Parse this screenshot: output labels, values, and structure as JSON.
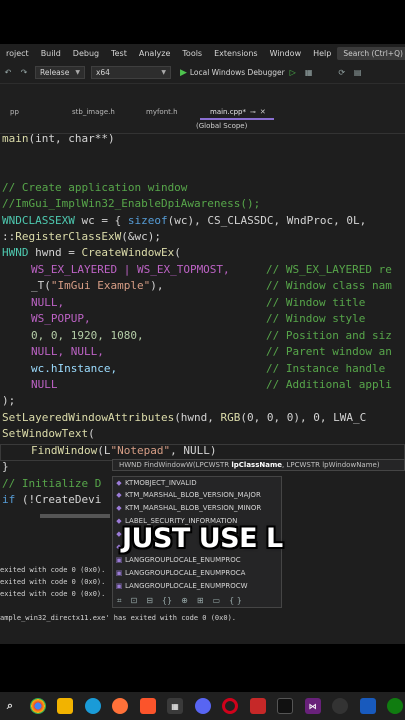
{
  "menu": {
    "items": [
      "roject",
      "Build",
      "Debug",
      "Test",
      "Analyze",
      "Tools",
      "Extensions",
      "Window",
      "Help"
    ],
    "search": "Search (Ctrl+Q)"
  },
  "toolbar": {
    "config": "Release",
    "platform": "x64",
    "run_label": "Local Windows Debugger"
  },
  "tabs": [
    {
      "label": "pp",
      "active": false
    },
    {
      "label": "stb_image.h",
      "active": false
    },
    {
      "label": "myfont.h",
      "active": false
    },
    {
      "label": "main.cpp*",
      "active": true
    }
  ],
  "scope": "(Global Scope)",
  "code": {
    "line1": {
      "kw": "main",
      "rest": "(int, char**)"
    },
    "comment1": "// Create application window",
    "comment2": "//ImGui_ImplWin32_EnableDpiAwareness();",
    "line_wc": {
      "ty": "WNDCLASSEXW",
      "a": " wc = { ",
      "kw": "sizeof",
      "b": "(wc), CS_CLASSDC, WndProc, 0L,"
    },
    "line_reg": {
      "a": "::",
      "fn": "RegisterClassExW",
      "b": "(&wc);"
    },
    "line_hwnd": {
      "ty": "HWND",
      "a": " hwnd = ",
      "fn": "CreateWindowEx",
      "b": "("
    },
    "line_ex": {
      "mc": "WS_EX_LAYERED | WS_EX_TOPMOST,",
      "cm": "// WS_EX_LAYERED re"
    },
    "line_t": {
      "a": "_T(",
      "st": "\"ImGui Example\"",
      "b": "),",
      "cm": "// Window class nam"
    },
    "line_null1": {
      "mc": "NULL,",
      "cm": "// Window title"
    },
    "line_popup": {
      "mc": "WS_POPUP,",
      "cm": "// Window style"
    },
    "line_pos": {
      "nm": "0, 0, 1920, 1080,",
      "cm": "// Position and siz"
    },
    "line_null2": {
      "mc": "NULL, NULL,",
      "cm": "// Parent window an"
    },
    "line_inst": {
      "id": "wc.hInstance,",
      "cm": "// Instance handle"
    },
    "line_null3": {
      "mc": "NULL",
      "cm": "// Additional appli"
    },
    "line_close": ");",
    "line_slwa": {
      "fn": "SetLayeredWindowAttributes",
      "a": "(hwnd, ",
      "fn2": "RGB",
      "b": "(0, 0, 0), 0, LWA_C"
    },
    "line_swt": {
      "fn": "SetWindowText",
      "a": "("
    },
    "line_find": {
      "fn": "FindWindow",
      "a": "(L",
      "st": "\"Notepad\"",
      "b": ", NULL)"
    },
    "line_brace": "}",
    "comment_init": "// Initialize D",
    "line_if": {
      "kw": "if",
      "a": " (!CreateDevi"
    }
  },
  "tooltip": {
    "sig": "HWND FindWindowW(LPCWSTR ",
    "param": "lpClassName",
    "rest": ", LPCWSTR lpWindowName)"
  },
  "completion": [
    "KTMOBJECT_INVALID",
    "KTM_MARSHAL_BLOB_VERSION_MAJOR",
    "KTM_MARSHAL_BLOB_VERSION_MINOR",
    "LABEL_SECURITY_INFORMATION",
    "",
    "",
    "LANGGROUPLOCALE_ENUMPROC",
    "LANGGROUPLOCALE_ENUMPROCA",
    "LANGGROUPLOCALE_ENUMPROCW"
  ],
  "caption": "JUST USE L",
  "output": {
    "line1": "exited with code 0 (0x0).",
    "line2": "exited with code 0 (0x0).",
    "line3": "exited with code 0 (0x0).",
    "line4": "ample_win32_directx11.exe' has exited with code 0 (0x0)."
  },
  "taskbar": [
    "search",
    "chrome",
    "files",
    "edge",
    "firefox",
    "brave",
    "store",
    "discord",
    "opera",
    "vpn",
    "jetbrains",
    "vs",
    "obs",
    "word",
    "xbox"
  ]
}
